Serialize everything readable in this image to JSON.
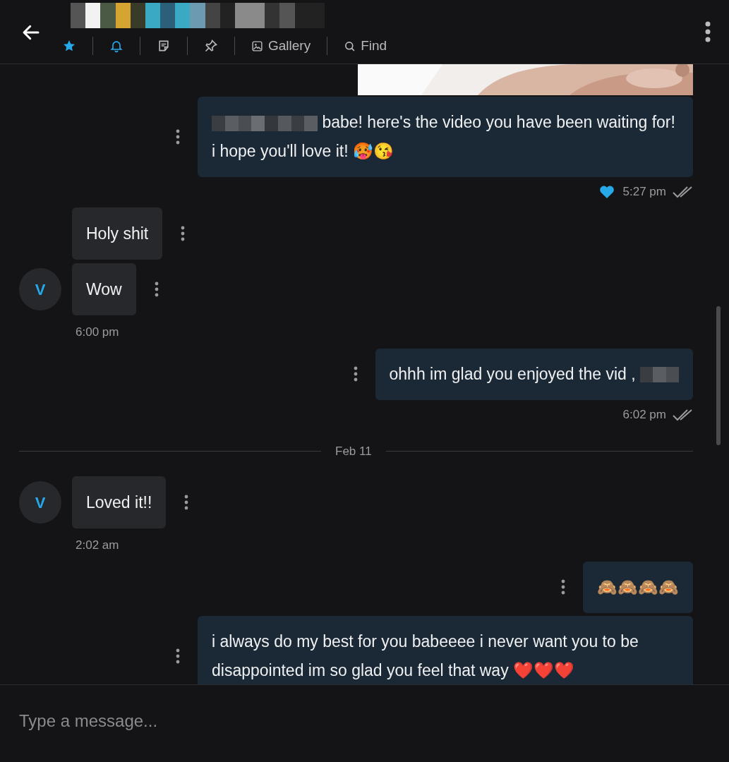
{
  "header": {
    "title_redacted": true,
    "toolbar": [
      {
        "kind": "star",
        "active": true
      },
      {
        "kind": "bell",
        "active": true
      },
      {
        "kind": "note",
        "active": false
      },
      {
        "kind": "pin",
        "active": false
      },
      {
        "kind": "gallery",
        "label": "Gallery",
        "active": false
      },
      {
        "kind": "search",
        "label": "Find",
        "active": false
      }
    ]
  },
  "items": [
    {
      "kind": "picture"
    },
    {
      "kind": "out",
      "text": "babe! here's the video you have been waiting for! i hope you'll love it! 🥵😘",
      "redacted_start": true
    },
    {
      "kind": "meta",
      "liked": true,
      "time": "5:27 pm",
      "read": true
    },
    {
      "kind": "in",
      "avatar": "V",
      "bubbles": [
        "Holy shit",
        "Wow"
      ],
      "time": "6:00 pm"
    },
    {
      "kind": "out",
      "text": "ohhh im glad you enjoyed the vid ,",
      "redacted_end": true
    },
    {
      "kind": "meta",
      "liked": false,
      "time": "6:02 pm",
      "read": true
    },
    {
      "kind": "divider",
      "text": "Feb 11"
    },
    {
      "kind": "in",
      "avatar": "V",
      "bubbles": [
        "Loved it!!"
      ],
      "time": "2:02 am"
    },
    {
      "kind": "out",
      "text": "🙈🙈🙈🙈"
    },
    {
      "kind": "out",
      "text": "i always do my best for you babeeee i never want you to be disappointed im so glad you feel that way ❤️❤️❤️"
    }
  ],
  "composer": {
    "placeholder": "Type a message..."
  }
}
